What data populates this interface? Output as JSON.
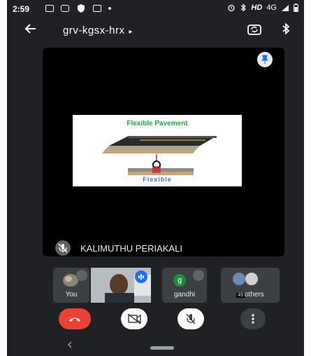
{
  "status_bar": {
    "time": "2:59",
    "right_text": "HD",
    "network": "4G"
  },
  "meeting": {
    "title": "grv-kgsx-hrx",
    "title_caret": "▸"
  },
  "presentation": {
    "slide_title": "Flexible Pavement",
    "slide_caption": "Flexible",
    "presenter_name": "KALIMUTHU PERIAKALI"
  },
  "participants": [
    {
      "name": "You",
      "muted": true
    },
    {
      "name": "",
      "speaking": true
    },
    {
      "name": "gandhi",
      "avatar_letter": "g",
      "muted": true
    },
    {
      "name": "others",
      "count": "49"
    }
  ],
  "colors": {
    "background": "#202124",
    "end_call": "#ea4335",
    "control_white": "#ffffff",
    "control_gray": "#3c4043",
    "speaking_blue": "#1a73e8",
    "slide_green": "#22a83a",
    "slide_blue": "#3a6fd8"
  },
  "icons": {
    "back": "arrow-left-icon",
    "switch_camera": "switch-camera-icon",
    "bluetooth": "bluetooth-icon",
    "pin": "pin-icon",
    "mic_off": "mic-off-icon",
    "camera_off": "camera-off-icon",
    "end_call": "end-call-icon",
    "more": "more-vert-icon"
  }
}
